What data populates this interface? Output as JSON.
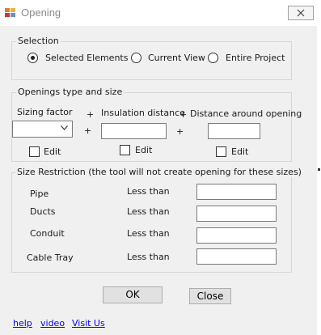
{
  "window": {
    "title": "Opening",
    "icon": "app-icon",
    "close_icon": "close-icon"
  },
  "selection": {
    "legend": "Selection",
    "options": [
      {
        "label": "Selected Elements",
        "selected": true
      },
      {
        "label": "Current View",
        "selected": false
      },
      {
        "label": "Entire Project",
        "selected": false
      }
    ]
  },
  "openings": {
    "legend": "Openings type and size",
    "sizing_factor_label": "Sizing factor",
    "insulation_label": "Insulation distance",
    "around_label": "Distance around opening",
    "plus": "+",
    "sizing_factor_value": "",
    "insulation_value": "",
    "around_value": "",
    "edit_label": "Edit",
    "dropdown_icon": "chevron-down-icon"
  },
  "restriction": {
    "legend": "Size Restriction (the tool will not create opening for these sizes)",
    "rows": [
      {
        "name": "Pipe",
        "condition": "Less than",
        "value": ""
      },
      {
        "name": "Ducts",
        "condition": "Less than",
        "value": ""
      },
      {
        "name": "Conduit",
        "condition": "Less than",
        "value": ""
      },
      {
        "name": "Cable Tray",
        "condition": "Less than",
        "value": ""
      }
    ]
  },
  "buttons": {
    "ok": "OK",
    "close": "Close"
  },
  "links": {
    "help": "help",
    "video": "video",
    "visit": "Visit Us"
  },
  "colors": {
    "window_bg": "#f0f0f0",
    "link": "#0000ee",
    "group_border": "#d6d6d6"
  }
}
